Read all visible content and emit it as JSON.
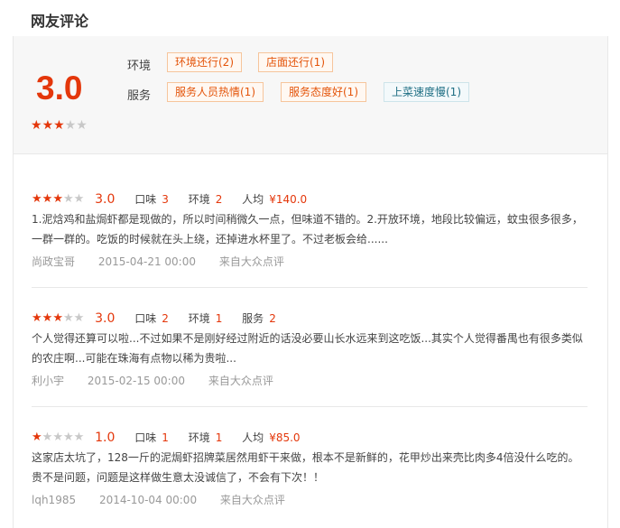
{
  "header": {
    "title": "网友评论"
  },
  "summary": {
    "score": "3.0",
    "stars": 3,
    "rows": [
      {
        "label": "环境",
        "tags": [
          {
            "text": "环境还行(2)",
            "negative": false
          },
          {
            "text": "店面还行(1)",
            "negative": false
          }
        ]
      },
      {
        "label": "服务",
        "tags": [
          {
            "text": "服务人员热情(1)",
            "negative": false
          },
          {
            "text": "服务态度好(1)",
            "negative": false
          },
          {
            "text": "上菜速度慢(1)",
            "negative": true
          }
        ]
      }
    ]
  },
  "reviews": [
    {
      "stars": 3,
      "score": "3.0",
      "metrics": [
        {
          "label": "口味",
          "value": "3"
        },
        {
          "label": "环境",
          "value": "2"
        },
        {
          "label": "人均",
          "value": "¥140.0"
        }
      ],
      "text": "1.泥焓鸡和盐焗虾都是现做的，所以时间稍微久一点，但味道不错的。2.开放环境，地段比较偏远，蚊虫很多很多，一群一群的。吃饭的时候就在头上绕，还掉进水杯里了。不过老板会给......",
      "author": "尚政宝哥",
      "date": "2015-04-21 00:00",
      "source": "来自大众点评"
    },
    {
      "stars": 3,
      "score": "3.0",
      "metrics": [
        {
          "label": "口味",
          "value": "2"
        },
        {
          "label": "环境",
          "value": "1"
        },
        {
          "label": "服务",
          "value": "2"
        }
      ],
      "text": "个人觉得还算可以啦...不过如果不是刚好经过附近的话没必要山长水远来到这吃饭...其实个人觉得番禺也有很多类似的农庄啊...可能在珠海有点物以稀为贵啦...",
      "author": "利小宇",
      "date": "2015-02-15 00:00",
      "source": "来自大众点评"
    },
    {
      "stars": 1,
      "score": "1.0",
      "metrics": [
        {
          "label": "口味",
          "value": "1"
        },
        {
          "label": "环境",
          "value": "1"
        },
        {
          "label": "人均",
          "value": "¥85.0"
        }
      ],
      "text": "这家店太坑了，128一斤的泥焗虾招牌菜居然用虾干来做，根本不是新鲜的，花甲炒出来壳比肉多4倍没什么吃的。贵不是问题，问题是这样做生意太没诚信了，不会有下次！！",
      "author": "lqh1985",
      "date": "2014-10-04 00:00",
      "source": "来自大众点评"
    }
  ]
}
